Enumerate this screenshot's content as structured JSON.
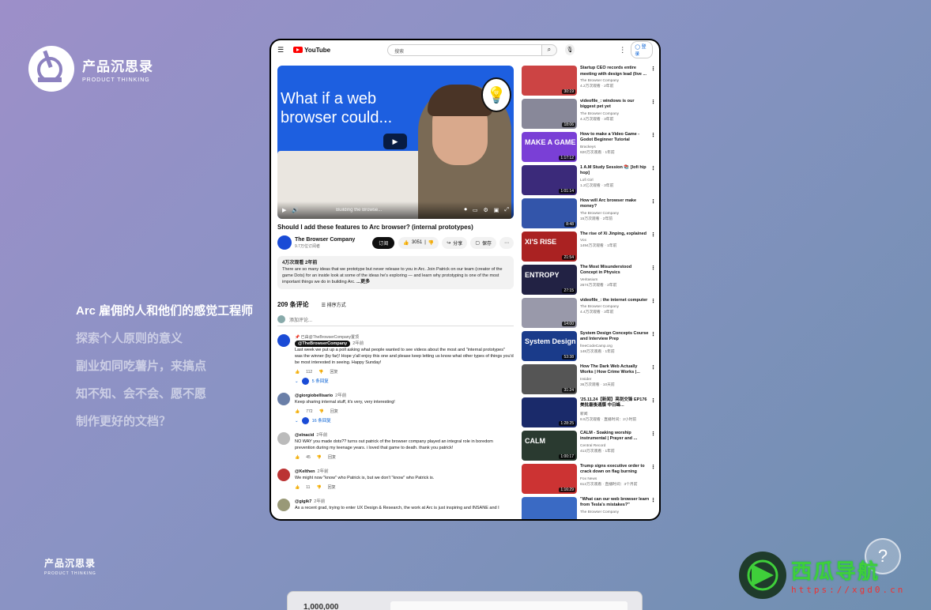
{
  "brand": {
    "cn": "产品沉思录",
    "en": "PRODUCT THINKING"
  },
  "menu": [
    {
      "label": "Arc 雇佣的人和他们的感觉工程师",
      "active": true
    },
    {
      "label": "探索个人原则的意义",
      "active": false
    },
    {
      "label": "副业如同吃薯片，来搞点",
      "active": false
    },
    {
      "label": "知不知、会不会、愿不愿",
      "active": false
    },
    {
      "label": "制作更好的文档？",
      "active": false
    }
  ],
  "help": "?",
  "watermark": {
    "title": "西瓜导航",
    "url": "https://xgd0.cn"
  },
  "bottom_card": {
    "value": "1,000,000"
  },
  "youtube": {
    "logo": "YouTube",
    "search_placeholder": "搜索",
    "login": "登录",
    "video": {
      "overlay_title_1": "What if a web",
      "overlay_title_2": "browser could...",
      "chapter": "Building the Browse...",
      "title": "Should I add these features to Arc browser? (internal prototypes)",
      "channel": "The Browser Company",
      "subs": "9.7万位订阅者",
      "subscribe": "订阅",
      "likes": "3051",
      "share": "分享",
      "save": "保存"
    },
    "description": {
      "meta": "4万次观看  2年前",
      "text": "There are so many ideas that we prototype but never release to you in Arc. Join Patrick on our team (creator of the game Dots) for an inside look at some of the ideas he's exploring — and learn why prototyping is one of the most important things we do in building Arc.",
      "more": "...更多"
    },
    "comments": {
      "count": "209 条评论",
      "sort": "排序方式",
      "add": "添加评论...",
      "reply": "回复",
      "items": [
        {
          "pinned": "已由@TheBrowserCompany置顶",
          "user": "@TheBrowserCompany",
          "time": "2年前",
          "text": "Last week we put up a poll asking what people wanted to see videos about the most and \"internal prototypes\" was the winner (by far)! Hope y'all enjoy this one and please keep letting us know what other types of things you'd be most interested in seeing. Happy Sunday!",
          "likes": "112",
          "replies": "5 条回复",
          "color": "#1a4bd6"
        },
        {
          "pinned": "",
          "user": "@giorgiobellisario",
          "time": "2年前",
          "text": "Keep sharing internal stuff, it's very, very interesting!",
          "likes": "772",
          "replies": "16 条回复",
          "color": "#6a7fa8"
        },
        {
          "pinned": "",
          "user": "@elnacid",
          "time": "2年前",
          "text": "NO WAY you made dots?? turns out patrick of the browser company played an integral role in boredom prevention during my teenage years. i loved that game to death. thank you patrick!",
          "likes": "45",
          "replies": "",
          "color": "#bbb"
        },
        {
          "pinned": "",
          "user": "@Kelthen",
          "time": "2年前",
          "text": "We might now \"know\" who Patrick is, but we don't \"know\" who Patrick is.",
          "likes": "11",
          "replies": "",
          "color": "#b33"
        },
        {
          "pinned": "",
          "user": "@gigik7",
          "time": "2年前",
          "text": "As a recent grad, trying to enter UX Design & Research, the work at Arc is just inspiring and INSANE and I",
          "likes": "",
          "replies": "",
          "color": "#997"
        }
      ]
    },
    "sidebar": [
      {
        "title": "Startup CEO records entire meeting with design lead (live ...",
        "channel": "The Browser Company",
        "meta": "4.2万次观看 · 2年前",
        "dur": "30:19",
        "bg": "#c44",
        "tx": ""
      },
      {
        "title": "videofile_: windows is our biggest pet yet",
        "channel": "The Browser Company",
        "meta": "4.3万次观看 · 3年前",
        "dur": "18:06",
        "bg": "#889",
        "tx": ""
      },
      {
        "title": "How to make a Video Game - Godot Beginner Tutorial",
        "channel": "Brackeys",
        "meta": "820万次观看 · 1年前",
        "dur": "1:17:12",
        "bg": "#7a3fd6",
        "tx": "MAKE A GAME"
      },
      {
        "title": "1 A.M Study Session 📚 [lofi hip hop]",
        "channel": "Lofi Girl",
        "meta": "1.2亿次观看 · 3年前",
        "dur": "1:01:14",
        "bg": "#3b2a7a",
        "tx": ""
      },
      {
        "title": "How will Arc browser make money?",
        "channel": "The Browser Company",
        "meta": "15万次观看 · 2年前",
        "dur": "8:48",
        "bg": "#3355aa",
        "tx": ""
      },
      {
        "title": "The rise of Xi Jinping, explained",
        "channel": "Vox",
        "meta": "1494万次观看 · 1年前",
        "dur": "21:54",
        "bg": "#a22",
        "tx": "XI'S RISE"
      },
      {
        "title": "The Most Misunderstood Concept in Physics",
        "channel": "Veritasium",
        "meta": "2674万次观看 · 2年前",
        "dur": "27:15",
        "bg": "#224",
        "tx": "ENTROPY"
      },
      {
        "title": "videofile_: the internet computer",
        "channel": "The Browser Company",
        "meta": "4.4万次观看 · 3年前",
        "dur": "14:00",
        "bg": "#99a",
        "tx": ""
      },
      {
        "title": "System Design Concepts Course and Interview Prep",
        "channel": "freeCodeCamp.org",
        "meta": "148万次观看 · 1年前",
        "dur": "53:38",
        "bg": "#1a3b8a",
        "tx": "System Design"
      },
      {
        "title": "How The Dark Web Actually Works | How Crime Works |...",
        "channel": "Insider",
        "meta": "36万次观看 · 10天前",
        "dur": "31:24",
        "bg": "#555",
        "tx": ""
      },
      {
        "title": "'25.11.24【新闻】亮剑交锋 EP176 美批最後通牒 中日峰...",
        "channel": "新闻",
        "meta": "8.9万次观看 · 直播时间：2小时前",
        "dur": "1:28:25",
        "bg": "#1a2a6a",
        "tx": ""
      },
      {
        "title": "CALM - Soaking worship instrumental | Prayer and ...",
        "channel": "Central Record",
        "meta": "413万次观看 · 1年前",
        "dur": "1:00:17",
        "bg": "#2a3a30",
        "tx": "CALM"
      },
      {
        "title": "Trump signs executive order to crack down on flag burning",
        "channel": "Fox News",
        "meta": "612万次观看 · 直播时间：3个月前",
        "dur": "1:16:29",
        "bg": "#c33",
        "tx": ""
      },
      {
        "title": "\"What can our web browser learn from Tesla's mistakes?\"",
        "channel": "The Browser Company",
        "meta": "",
        "dur": "",
        "bg": "#3a6ac4",
        "tx": ""
      }
    ]
  }
}
